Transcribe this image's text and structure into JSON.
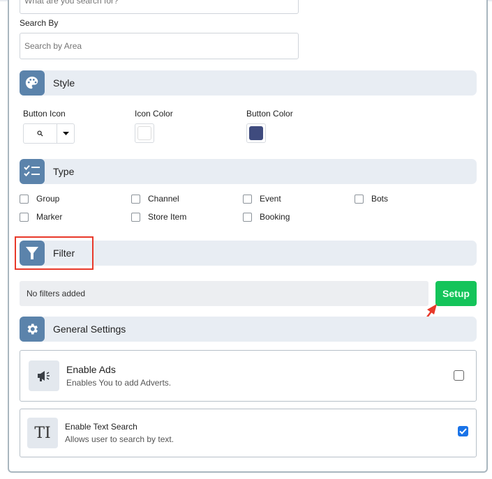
{
  "search": {
    "query_placeholder": "What are you search for?",
    "search_by_label": "Search By",
    "area_placeholder": "Search by Area"
  },
  "style": {
    "title": "Style",
    "button_icon_label": "Button Icon",
    "button_icon_value": "search-icon",
    "icon_color_label": "Icon Color",
    "icon_color": "#ffffff",
    "button_color_label": "Button Color",
    "button_color": "#3f4b7e"
  },
  "type": {
    "title": "Type",
    "options": [
      {
        "label": "Group",
        "checked": false
      },
      {
        "label": "Channel",
        "checked": false
      },
      {
        "label": "Event",
        "checked": false
      },
      {
        "label": "Bots",
        "checked": false
      },
      {
        "label": "Marker",
        "checked": false
      },
      {
        "label": "Store Item",
        "checked": false
      },
      {
        "label": "Booking",
        "checked": false
      }
    ]
  },
  "filter": {
    "title": "Filter",
    "empty_text": "No filters added",
    "setup_label": "Setup"
  },
  "general": {
    "title": "General Settings",
    "settings": [
      {
        "title": "Enable Ads",
        "description": "Enables You to add Adverts.",
        "icon": "megaphone-icon",
        "checked": false
      },
      {
        "title": "Enable Text Search",
        "description": "Allows user to search by text.",
        "icon": "text-icon",
        "checked": true
      }
    ]
  },
  "colors": {
    "section_icon_bg": "#5b83ab",
    "section_bg": "#e8edf3",
    "setup_green": "#14c45a",
    "checkbox_blue": "#1a73e8",
    "annotation_red": "#e8392a"
  }
}
